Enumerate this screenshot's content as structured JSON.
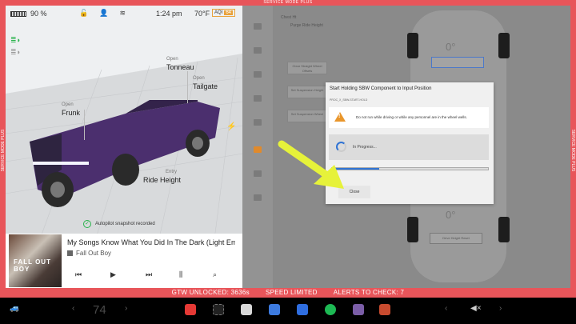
{
  "frame": {
    "service_mode_label": "SERVICE MODE PLUS",
    "accent": "#e8555a"
  },
  "status_bar": {
    "battery_percent": "90 %",
    "time": "1:24 pm",
    "temperature": "70°F",
    "aqi_label": "AQI",
    "aqi_value": "64",
    "icons": [
      "lock-open-icon",
      "profile-icon",
      "wifi-icon"
    ]
  },
  "car": {
    "labels": {
      "tonneau_state": "Open",
      "tonneau": "Tonneau",
      "tailgate_state": "Open",
      "tailgate": "Tailgate",
      "frunk_state": "Open",
      "frunk": "Frunk",
      "ride_height_state": "Entry",
      "ride_height": "Ride Height"
    },
    "autopilot_message": "Autopilot snapshot recorded"
  },
  "media": {
    "track": "My Songs Know What You Did In The Dark (Light Em",
    "artist": "Fall Out Boy",
    "album_art_text": "FALL OUT BOY"
  },
  "service": {
    "sidebar_active_index": 6,
    "text_labels": [
      "Chest Ht",
      "Purge Ride Height",
      "Clear Straight Wheel Offsets",
      "Set Suspension Height",
      "Set Suspension Wheel",
      "Drive Height Reset"
    ],
    "wheel_value": "0°",
    "dialog": {
      "title": "Start Holding SBW Component to Input Position",
      "routine_id": "PROC_X_SBW-START-HOLD",
      "warning": "Do not run while driving or while any personnel are in the wheel wells.",
      "progress_text": "In Progress...",
      "progress_fraction": 0.3,
      "close_label": "Close"
    },
    "pointer_color": "#e6f23a"
  },
  "alert_bar": {
    "gtw": "GTW UNLOCKED: 3636s",
    "speed": "SPEED LIMITED",
    "alerts": "ALERTS TO CHECK: 7"
  },
  "taskbar": {
    "speed": "74",
    "apps": [
      {
        "name": "service-tool-icon",
        "color": "#e53935"
      },
      {
        "name": "more-icon",
        "color": "#222"
      },
      {
        "name": "calendar-icon",
        "color": "#d9d9d9"
      },
      {
        "name": "navigation-icon",
        "color": "#3d7be0"
      },
      {
        "name": "bluetooth-icon",
        "color": "#2f6ee0"
      },
      {
        "name": "spotify-icon",
        "color": "#1db954"
      },
      {
        "name": "toybox-icon",
        "color": "#7b5ea7"
      },
      {
        "name": "arcade-icon",
        "color": "#c84b2f"
      }
    ]
  }
}
